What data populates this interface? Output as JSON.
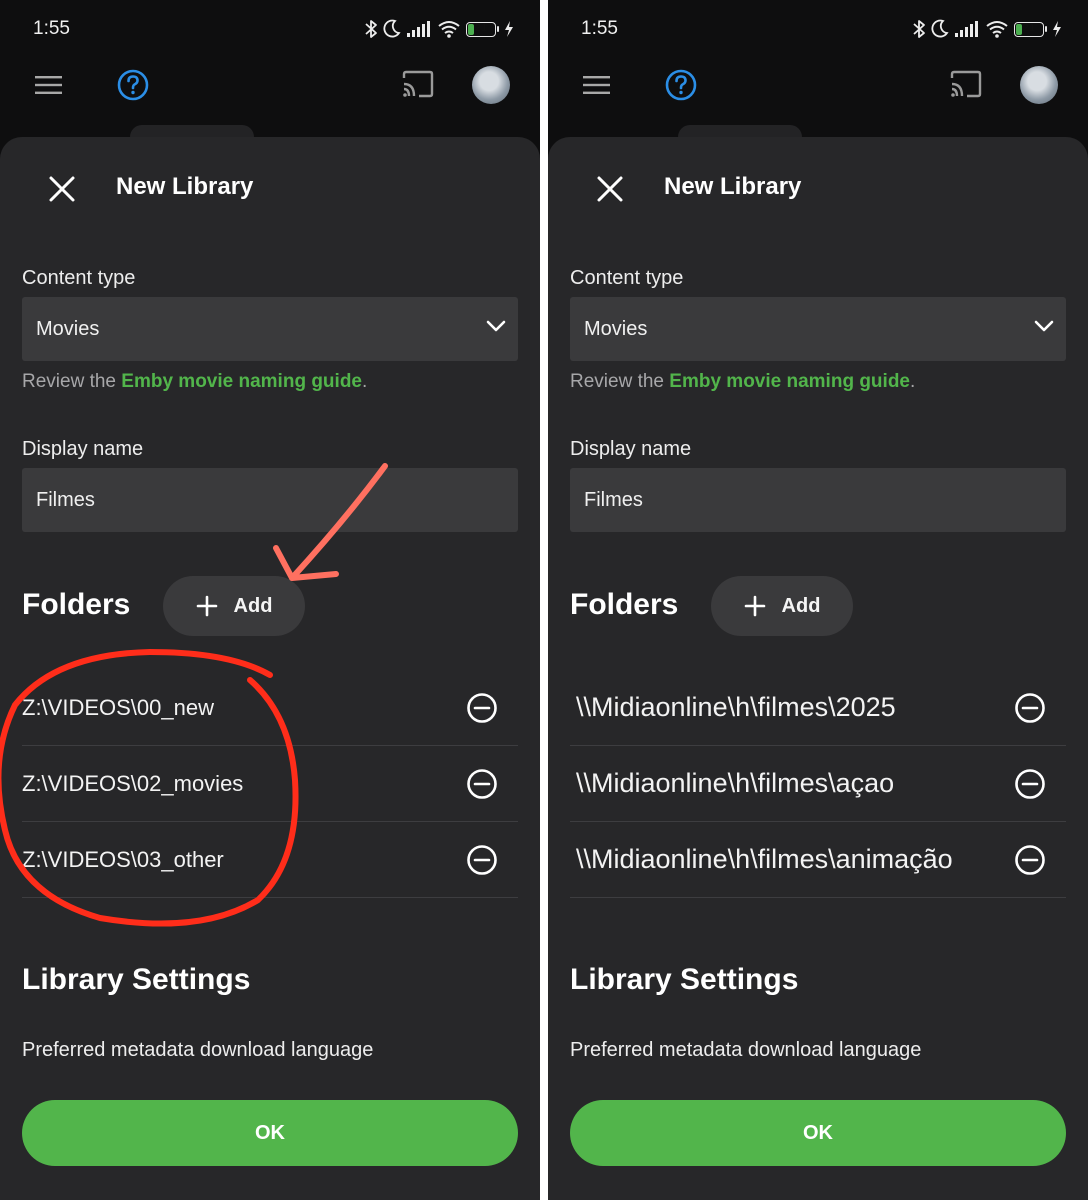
{
  "panels": [
    {
      "status": {
        "time": "1:55",
        "battery": "21"
      },
      "sheet": {
        "title": "New Library",
        "content_type_label": "Content type",
        "content_type_value": "Movies",
        "review_prefix": "Review the ",
        "review_link": "Emby movie naming guide",
        "review_suffix": ".",
        "display_name_label": "Display name",
        "display_name_value": "Filmes",
        "folders_title": "Folders",
        "add_label": "Add",
        "folders": [
          "Z:\\VIDEOS\\00_new",
          "Z:\\VIDEOS\\02_movies",
          "Z:\\VIDEOS\\03_other"
        ],
        "library_settings_title": "Library Settings",
        "metadata_language_label": "Preferred metadata download language",
        "ok_label": "OK"
      }
    },
    {
      "status": {
        "time": "1:55",
        "battery": "21"
      },
      "sheet": {
        "title": "New Library",
        "content_type_label": "Content type",
        "content_type_value": "Movies",
        "review_prefix": "Review the ",
        "review_link": "Emby movie naming guide",
        "review_suffix": ".",
        "display_name_label": "Display name",
        "display_name_value": "Filmes",
        "folders_title": "Folders",
        "add_label": "Add",
        "folders": [
          "\\\\Midiaonline\\h\\filmes\\2025",
          "\\\\Midiaonline\\h\\filmes\\açao",
          "\\\\Midiaonline\\h\\filmes\\animação"
        ],
        "library_settings_title": "Library Settings",
        "metadata_language_label": "Preferred metadata download language",
        "ok_label": "OK"
      }
    }
  ],
  "colors": {
    "accent_green": "#52b54b",
    "sheet_bg": "#272729",
    "field_bg": "#3a3a3c",
    "annotation_red": "#ff2d1a",
    "arrow_salmon": "#ff7060",
    "help_icon_blue": "#2b8ee6"
  },
  "icons": [
    "menu-icon",
    "help-icon",
    "cast-icon",
    "close-icon",
    "chevron-down-icon",
    "plus-icon",
    "remove-circle-icon",
    "bluetooth-icon",
    "moon-icon",
    "signal-icon",
    "wifi-icon",
    "charging-icon"
  ]
}
